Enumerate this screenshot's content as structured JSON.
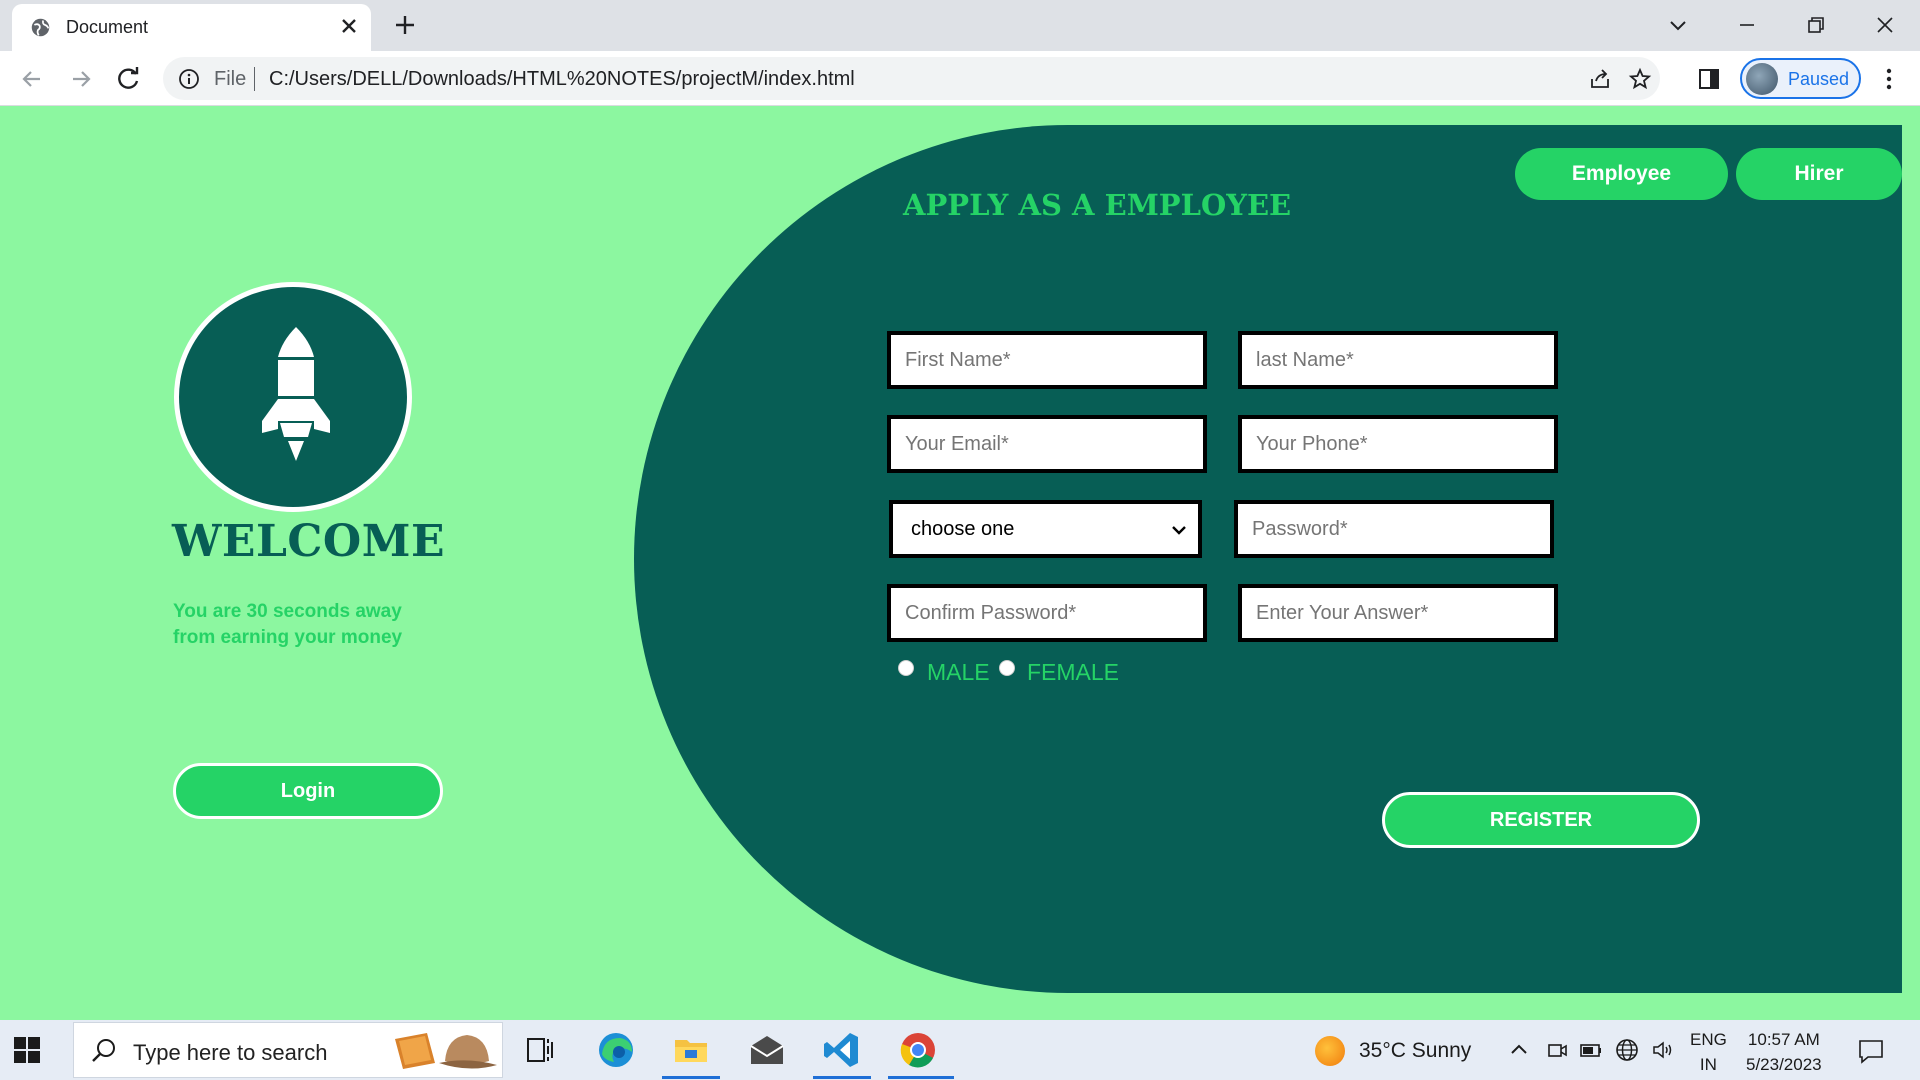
{
  "browser": {
    "tab_title": "Document",
    "omnibox": {
      "scheme_label": "File",
      "url": "C:/Users/DELL/Downloads/HTML%20NOTES/projectM/index.html"
    },
    "profile_status": "Paused"
  },
  "page": {
    "left": {
      "welcome_title": "WELCOME",
      "subtitle_line1": "You are 30 seconds away",
      "subtitle_line2": "from earning your money",
      "login_label": "Login"
    },
    "panel": {
      "employee_tab": "Employee",
      "hirer_tab": "Hirer",
      "form_title": "APPLY AS A EMPLOYEE",
      "fields": {
        "first_name": "First Name*",
        "last_name": "last Name*",
        "email": "Your Email*",
        "phone": "Your Phone*",
        "select_value": "choose one",
        "password": "Password*",
        "confirm_password": "Confirm Password*",
        "answer": "Enter Your Answer*"
      },
      "gender": {
        "male": "MALE",
        "female": "FEMALE"
      },
      "register_label": "REGISTER"
    }
  },
  "taskbar": {
    "search_placeholder": "Type here to search",
    "weather": "35°C  Sunny",
    "lang_top": "ENG",
    "lang_bottom": "IN",
    "time": "10:57 AM",
    "date": "5/23/2023"
  },
  "colors": {
    "page_bg": "#8cf7a0",
    "panel_bg": "#075e55",
    "accent_green": "#25d366"
  }
}
